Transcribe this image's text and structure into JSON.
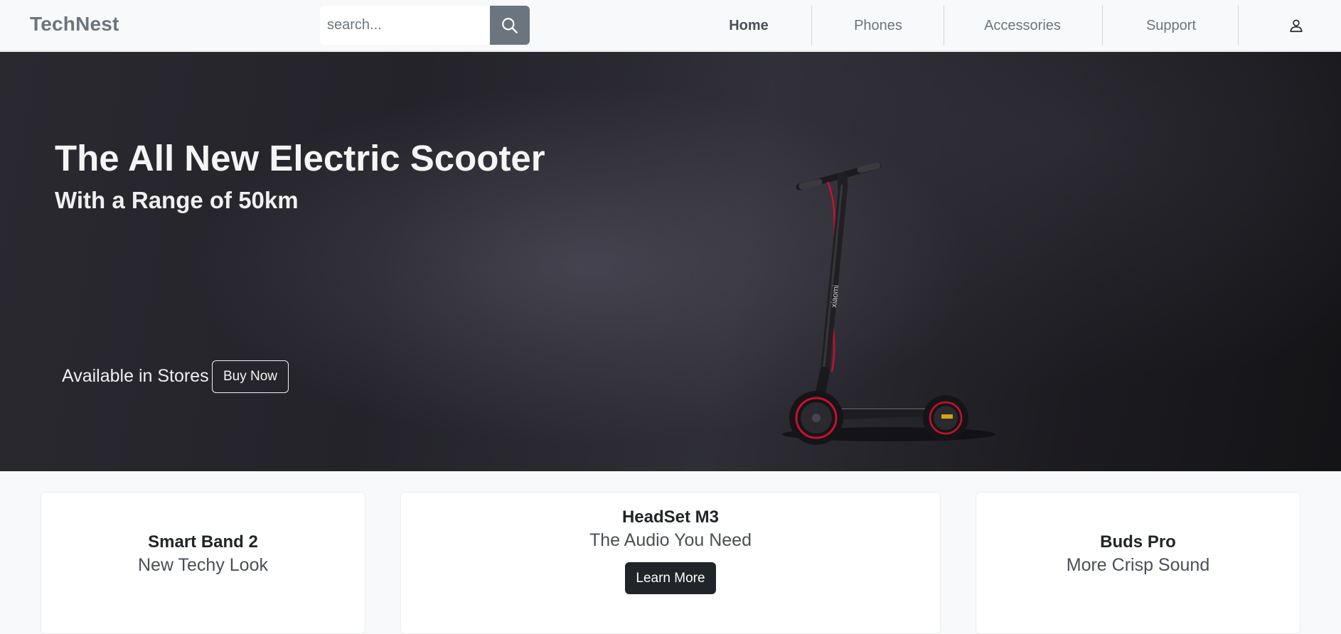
{
  "brand": "TechNest",
  "search": {
    "placeholder": "search...",
    "icon": "search-icon"
  },
  "nav": {
    "items": [
      {
        "label": "Home",
        "active": true
      },
      {
        "label": "Phones",
        "active": false
      },
      {
        "label": "Accessories",
        "active": false
      },
      {
        "label": "Support",
        "active": false
      }
    ],
    "user_icon": "person-icon"
  },
  "hero": {
    "title": "The All New Electric Scooter",
    "subtitle": "With a Range of 50km",
    "availability": "Available in Stores",
    "cta": "Buy Now",
    "scooter_brand_text": "xiaomi"
  },
  "cards": [
    {
      "title": "Smart Band 2",
      "subtitle": "New Techy Look"
    },
    {
      "title": "HeadSet M3",
      "subtitle": "The Audio You Need",
      "cta": "Learn More"
    },
    {
      "title": "Buds Pro",
      "subtitle": "More Crisp Sound"
    }
  ],
  "colors": {
    "navbar_bg": "#f8f9fa",
    "brand": "#6c757d",
    "search_button": "#6c757d",
    "hero_bg": "#2a2930",
    "dark_button": "#212529",
    "scooter_accent": "#d0103a"
  }
}
